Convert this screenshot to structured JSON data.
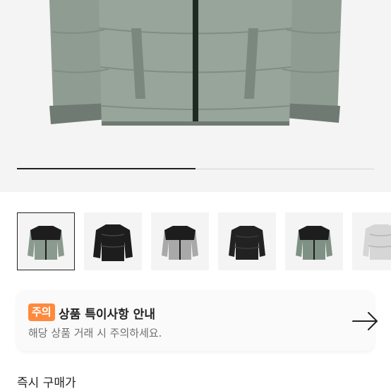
{
  "product_gallery": {
    "progress_fraction": 0.5,
    "thumbnails": [
      {
        "name": "thumb-green-jacket",
        "selected": true
      },
      {
        "name": "thumb-black-glossy-jacket",
        "selected": false
      },
      {
        "name": "thumb-grey-jacket",
        "selected": false
      },
      {
        "name": "thumb-black-matte-jacket",
        "selected": false
      },
      {
        "name": "thumb-green-jacket-alt",
        "selected": false
      },
      {
        "name": "thumb-silver-jacket",
        "selected": false
      }
    ]
  },
  "notice": {
    "badge": "주의",
    "title": "상품 특이사항 안내",
    "description": "해당 상품 거래 시 주의하세요.",
    "arrow_icon": "arrow-right-icon"
  },
  "section": {
    "instant_buy_label": "즉시 구매가"
  },
  "colors": {
    "accent": "#ff8a3d",
    "jacket_green": "#8b9a8f",
    "jacket_black": "#1d1d1d"
  }
}
